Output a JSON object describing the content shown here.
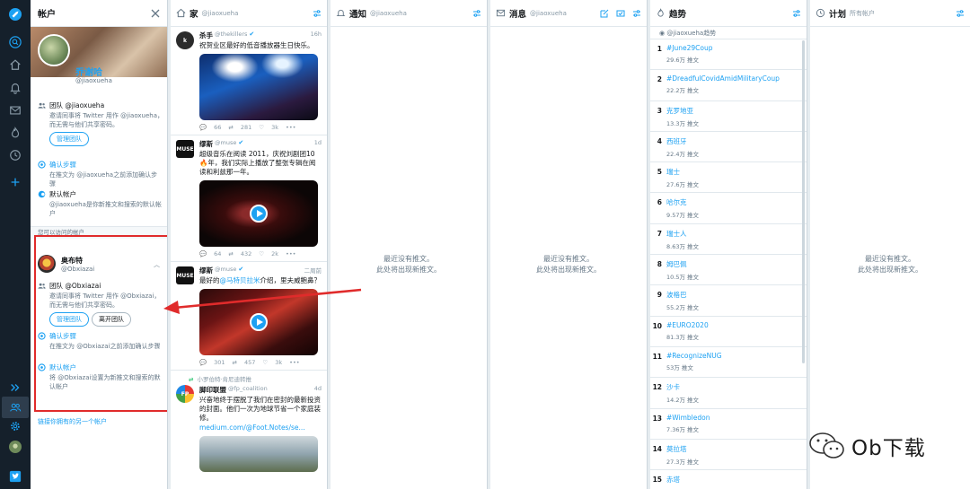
{
  "accounts_panel": {
    "title": "帐户",
    "primary": {
      "name": "乔谢哈",
      "handle": "@jiaoxueha",
      "team": {
        "label": "团队 @jiaoxueha",
        "desc": "邀请同事将 Twitter 用作 @jiaoxueha，而无需与他们共享密码。",
        "button": "管理团队"
      },
      "confirm": {
        "label": "确认步骤",
        "desc": "在推文为 @jiaoxueha之前添加确认步骤"
      },
      "default": {
        "label": "默认帐户",
        "desc": "@jiaoxueha是你新推文和搜索的默认帐户"
      }
    },
    "divider_text": "您可以访问的帐户",
    "secondary": {
      "name": "奥布特",
      "handle": "@Obxiazai",
      "team": {
        "label": "团队 @Obxiazai",
        "desc": "邀请同事将 Twitter 用作 @Obxiazai，而无需与他们共享密码。",
        "button_manage": "管理团队",
        "button_leave": "离开团队"
      },
      "confirm": {
        "label": "确认步骤",
        "desc": "在推文为 @Obxiazai之前添加确认步骤"
      },
      "default": {
        "label": "默认帐户",
        "desc": "将 @Obxiazai设置为新推文和搜索的默认帐户"
      }
    },
    "link_another": "链接你拥有的另一个帐户"
  },
  "columns": {
    "home": {
      "title": "家",
      "subtitle": "@jiaoxueha",
      "tweets": [
        {
          "avatar": "k",
          "name": "杀手",
          "handle": "@thekillers",
          "verified": true,
          "time": "16h",
          "text": "祝贺业区最好的低音播放器生日快乐。",
          "replies": "66",
          "retweets": "281",
          "likes": "3k",
          "media": "concert"
        },
        {
          "avatar": "MUSE",
          "name": "缪斯",
          "handle": "@muse",
          "verified": true,
          "time": "1d",
          "text": "超级音乐在阅读 2011，庆祝刘剧团10🔥年，我们实际上播放了整张专辑在阅读和利兹那一年。",
          "replies": "64",
          "retweets": "432",
          "likes": "2k",
          "media": "video"
        },
        {
          "avatar": "MUSE",
          "name": "缪斯",
          "handle": "@muse",
          "verified": true,
          "time": "二周前",
          "text_before": "最好的",
          "text_link": "@马特贝拉米",
          "text_after": "介绍，里夫威鲍鼻？",
          "replies": "301",
          "retweets": "457",
          "likes": "3k",
          "media": "video"
        },
        {
          "retweeted_by": "小罗伯特·肯尼迪转推",
          "avatar": "FP",
          "name": "脚印联盟",
          "handle": "@fp_coalition",
          "verified": false,
          "time": "4d",
          "text": "兴奋地终于摆脱了我们在密封的最新投资的封面。他们一次为地球节省一个家庭装修。",
          "link": "medium.com/@Foot.Notes/se..."
        }
      ]
    },
    "notifications": {
      "title": "通知",
      "subtitle": "@jiaoxueha",
      "empty_line1": "最近没有推文。",
      "empty_line2": "此处将出现新推文。"
    },
    "messages": {
      "title": "消息",
      "subtitle": "@jiaoxueha",
      "empty_line1": "最近没有推文。",
      "empty_line2": "此处将出现新推文。"
    },
    "trends": {
      "title": "趋势",
      "subtitle": "@jiaoxueha趋势",
      "items": [
        {
          "rank": "1",
          "name": "#June29Coup",
          "count": "29.6万 推文"
        },
        {
          "rank": "2",
          "name": "#DreadfulCovidAmidMilitaryCoup",
          "count": "22.2万 推文"
        },
        {
          "rank": "3",
          "name": "克罗地亚",
          "count": "13.3万 推文"
        },
        {
          "rank": "4",
          "name": "西班牙",
          "count": "22.4万 推文"
        },
        {
          "rank": "5",
          "name": "瑞士",
          "count": "27.6万 推文"
        },
        {
          "rank": "6",
          "name": "哈尔克",
          "count": "9.57万 推文"
        },
        {
          "rank": "7",
          "name": "瑞士人",
          "count": "8.63万 推文"
        },
        {
          "rank": "8",
          "name": "姆巴佩",
          "count": "10.5万 推文"
        },
        {
          "rank": "9",
          "name": "波格巴",
          "count": "55.2万 推文"
        },
        {
          "rank": "10",
          "name": "#EURO2020",
          "count": "81.3万 推文"
        },
        {
          "rank": "11",
          "name": "#RecognizeNUG",
          "count": "53万 推文"
        },
        {
          "rank": "12",
          "name": "沙卡",
          "count": "14.2万 推文"
        },
        {
          "rank": "13",
          "name": "#Wimbledon",
          "count": "7.36万 推文"
        },
        {
          "rank": "14",
          "name": "莫拉塔",
          "count": "27.3万 推文"
        },
        {
          "rank": "15",
          "name": "赤塔",
          "count": ""
        }
      ]
    },
    "scheduled": {
      "title": "计划",
      "subtitle": "所有帐户",
      "empty_line1": "最近没有推文。",
      "empty_line2": "此处将出现新推文。"
    }
  },
  "watermark": {
    "text": "Ob下载"
  },
  "colors": {
    "accent": "#1da1f2",
    "rail": "#15202b",
    "highlight_box": "#e02b2b"
  }
}
